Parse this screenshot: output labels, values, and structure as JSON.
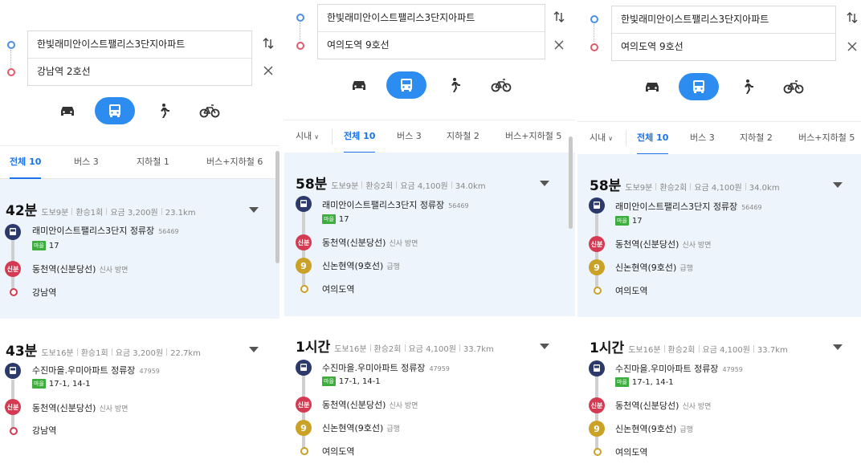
{
  "panels": [
    {
      "origin": "한빛래미안이스트팰리스3단지아파트",
      "destination": "강남역 2호선",
      "has_filter": false,
      "tabs": [
        {
          "label": "전체 10",
          "active": true
        },
        {
          "label": "버스 3",
          "active": false
        },
        {
          "label": "지하철 1",
          "active": false
        },
        {
          "label": "버스+지하철 6",
          "active": false
        }
      ],
      "routes": [
        {
          "time": "42분",
          "meta": [
            "도보9분",
            "환승1회",
            "요금 3,200원",
            "23.1km"
          ],
          "bus_stop": "래미안이스트팰리스3단지 정류장",
          "bus_stop_id": "56469",
          "bus_type": "마을",
          "bus_numbers": "17",
          "transfer_station": "동천역(신분당선)",
          "transfer_badge": "신분",
          "transfer_dir": "신사 방면",
          "end_station": "강남역"
        },
        {
          "time": "43분",
          "meta": [
            "도보16분",
            "환승1회",
            "요금 3,200원",
            "22.7km"
          ],
          "bus_stop": "수진마을.우미아파트 정류장",
          "bus_stop_id": "47959",
          "bus_type": "마을",
          "bus_numbers": "17-1, 14-1",
          "transfer_station": "동천역(신분당선)",
          "transfer_badge": "신분",
          "transfer_dir": "신사 방면",
          "end_station": "강남역"
        }
      ]
    },
    {
      "origin": "한빛래미안이스트팰리스3단지아파트",
      "destination": "여의도역 9호선",
      "has_filter": true,
      "filter_label": "시내",
      "tabs": [
        {
          "label": "전체 10",
          "active": true
        },
        {
          "label": "버스 3",
          "active": false
        },
        {
          "label": "지하철 2",
          "active": false
        },
        {
          "label": "버스+지하철 5",
          "active": false
        }
      ],
      "routes": [
        {
          "time": "58분",
          "meta": [
            "도보9분",
            "환승2회",
            "요금 4,100원",
            "34.0km"
          ],
          "bus_stop": "래미안이스트팰리스3단지 정류장",
          "bus_stop_id": "56469",
          "bus_type": "마을",
          "bus_numbers": "17",
          "transfer_station": "동천역(신분당선)",
          "transfer_badge": "신분",
          "transfer_dir": "신사 방면",
          "transfer2_station": "신논현역(9호선)",
          "transfer2_badge": "9",
          "transfer2_dir": "급행",
          "end_station": "여의도역"
        },
        {
          "time": "1시간",
          "meta": [
            "도보16분",
            "환승2회",
            "요금 4,100원",
            "33.7km"
          ],
          "bus_stop": "수진마을.우미아파트 정류장",
          "bus_stop_id": "47959",
          "bus_type": "마을",
          "bus_numbers": "17-1, 14-1",
          "transfer_station": "동천역(신분당선)",
          "transfer_badge": "신분",
          "transfer_dir": "신사 방면",
          "transfer2_station": "신논현역(9호선)",
          "transfer2_badge": "9",
          "transfer2_dir": "급행",
          "end_station": "여의도역"
        }
      ]
    },
    {
      "origin": "한빛래미안이스트팰리스3단지아파트",
      "destination": "여의도역 9호선",
      "has_filter": true,
      "filter_label": "시내",
      "tabs": [
        {
          "label": "전체 10",
          "active": true
        },
        {
          "label": "버스 3",
          "active": false
        },
        {
          "label": "지하철 2",
          "active": false
        },
        {
          "label": "버스+지하철 5",
          "active": false
        }
      ],
      "routes": [
        {
          "time": "58분",
          "meta": [
            "도보9분",
            "환승2회",
            "요금 4,100원",
            "34.0km"
          ],
          "bus_stop": "래미안이스트팰리스3단지 정류장",
          "bus_stop_id": "56469",
          "bus_type": "마을",
          "bus_numbers": "17",
          "transfer_station": "동천역(신분당선)",
          "transfer_badge": "신분",
          "transfer_dir": "신사 방면",
          "transfer2_station": "신논현역(9호선)",
          "transfer2_badge": "9",
          "transfer2_dir": "급행",
          "end_station": "여의도역"
        },
        {
          "time": "1시간",
          "meta": [
            "도보16분",
            "환승2회",
            "요금 4,100원",
            "33.7km"
          ],
          "bus_stop": "수진마을.우미아파트 정류장",
          "bus_stop_id": "47959",
          "bus_type": "마을",
          "bus_numbers": "17-1, 14-1",
          "transfer_station": "동천역(신분당선)",
          "transfer_badge": "신분",
          "transfer_dir": "신사 방면",
          "transfer2_station": "신논현역(9호선)",
          "transfer2_badge": "9",
          "transfer2_dir": "급행",
          "end_station": "여의도역"
        }
      ]
    }
  ],
  "icons": {
    "swap": "swap-vertical-icon",
    "clear": "close-icon",
    "modes": [
      "car-icon",
      "bus-icon",
      "walk-icon",
      "bicycle-icon"
    ],
    "active_mode": "bus-icon"
  },
  "colors": {
    "accent": "#2d8cf0",
    "active_tab": "#1a73e8",
    "selected_card_bg": "#eef4fb",
    "bus_badge": "#2b3a6b",
    "sinbundang": "#d43b52",
    "line9": "#c9a227",
    "maeul_bus": "#3dad3d"
  }
}
